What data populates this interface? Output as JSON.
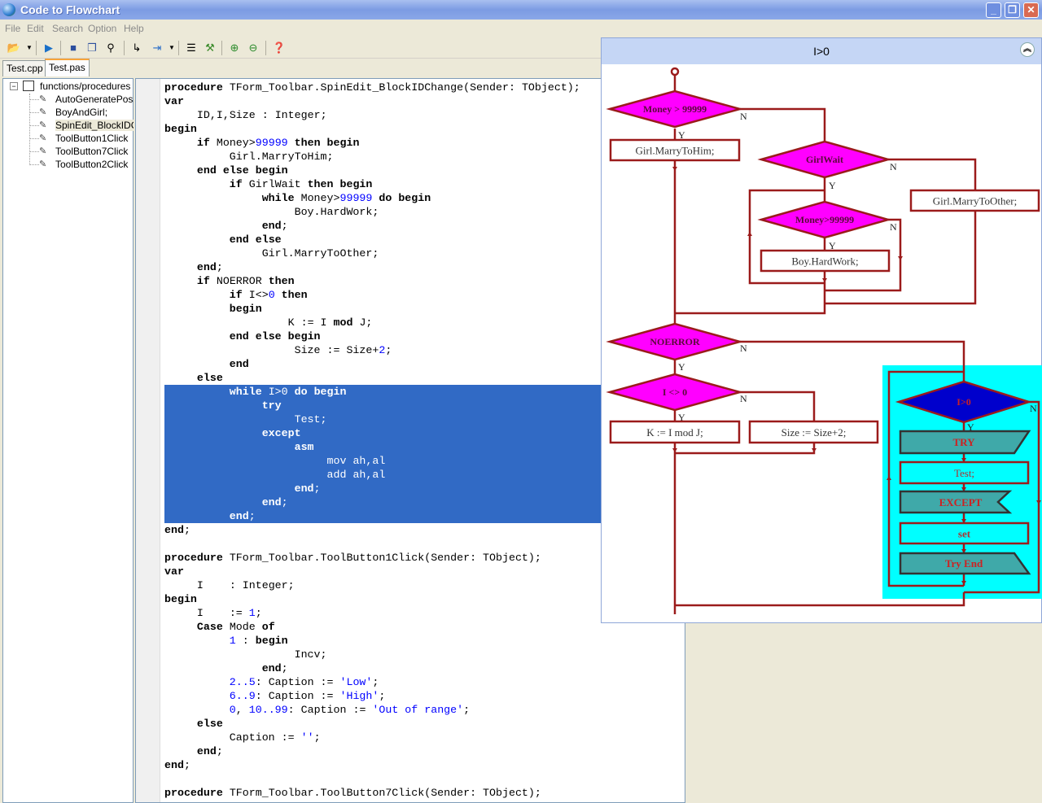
{
  "window": {
    "title": "Code to Flowchart",
    "min": "_",
    "max": "❐",
    "close": "✕"
  },
  "menu": [
    "File",
    "Edit",
    "Search",
    "Option",
    "Help"
  ],
  "toolbar": {
    "icons": [
      "open-folder-icon",
      "run-icon",
      "save-icon",
      "save-all-icon",
      "find-icon",
      "goto-icon",
      "insert-icon",
      "list-icon",
      "tools-icon",
      "zoom-in-icon",
      "zoom-out-icon",
      "help-icon"
    ]
  },
  "tabs": [
    {
      "label": "Test.cpp"
    },
    {
      "label": "Test.pas",
      "active": true
    }
  ],
  "tree": {
    "root": "functions/procedures",
    "items": [
      "AutoGeneratePoss;",
      "BoyAndGirl;",
      "SpinEdit_BlockIDCh",
      "ToolButton1Click",
      "ToolButton7Click",
      "ToolButton2Click"
    ],
    "selected": 2
  },
  "code": {
    "selected_range": [
      22,
      31
    ],
    "lines": [
      "procedure TForm_Toolbar.SpinEdit_BlockIDChange(Sender: TObject);",
      "var",
      "     ID,I,Size : Integer;",
      "begin",
      "     if Money>99999 then begin",
      "          Girl.MarryToHim;",
      "     end else begin",
      "          if GirlWait then begin",
      "               while Money>99999 do begin",
      "                    Boy.HardWork;",
      "               end;",
      "          end else",
      "               Girl.MarryToOther;",
      "     end;",
      "     if NOERROR then",
      "          if I<>0 then",
      "          begin",
      "                   K := I mod J;",
      "          end else begin",
      "                    Size := Size+2;",
      "          end",
      "     else",
      "          while I>0 do begin",
      "               try",
      "                    Test;",
      "               except",
      "                    asm",
      "                         mov ah,al",
      "                         add ah,al",
      "                    end;",
      "               end;",
      "          end;",
      "end;",
      "",
      "procedure TForm_Toolbar.ToolButton1Click(Sender: TObject);",
      "var",
      "     I    : Integer;",
      "begin",
      "     I    := 1;",
      "     Case Mode of",
      "          1 : begin",
      "                    Incv;",
      "               end;",
      "          2..5: Caption := 'Low';",
      "          6..9: Caption := 'High';",
      "          0, 10..99: Caption := 'Out of range';",
      "     else",
      "          Caption := '';",
      "     end;",
      "end;",
      "",
      "procedure TForm_Toolbar.ToolButton7Click(Sender: TObject);"
    ]
  },
  "flowchart": {
    "title": "I>0",
    "colors": {
      "line": "#9B1B1B",
      "decision": "#FF00FF",
      "loop_decision": "#0000CC",
      "loop_bg": "#00FFFF",
      "block": "#3FA9A9"
    },
    "yes": "Y",
    "no": "N",
    "nodes": {
      "d1": "Money > 99999",
      "p1": "Girl.MarryToHim;",
      "d2": "GirlWait",
      "p2": "Girl.MarryToOther;",
      "d3": "Money>99999",
      "p3": "Boy.HardWork;",
      "d4": "NOERROR",
      "d5": "I <> 0",
      "p4": "K := I mod J;",
      "p5": "Size := Size+2;",
      "d6": "I>0",
      "try": "TRY",
      "test": "Test;",
      "except": "EXCEPT",
      "set": "set",
      "tryend": "Try End"
    }
  }
}
